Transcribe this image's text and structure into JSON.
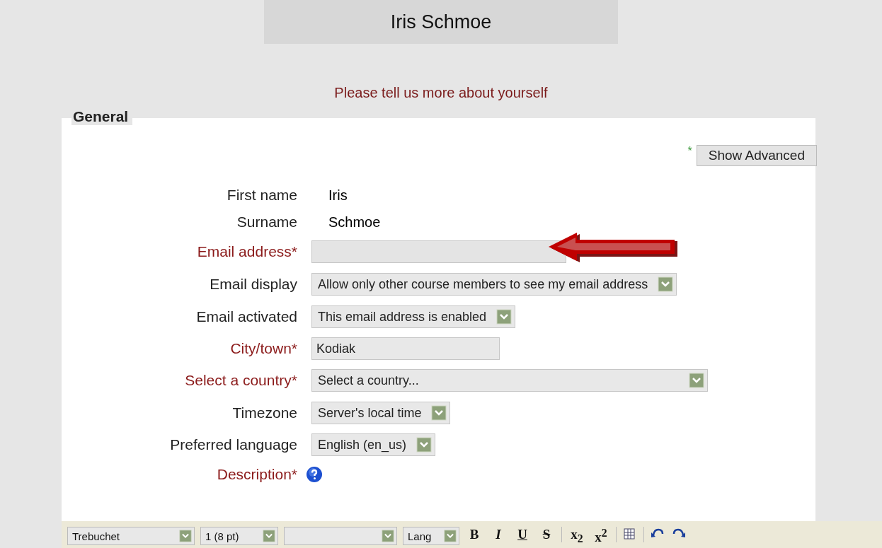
{
  "header": {
    "title": "Iris Schmoe",
    "subtitle": "Please tell us more about yourself"
  },
  "section": {
    "legend": "General",
    "advanced_button": {
      "label": "Show Advanced",
      "marker": "*"
    }
  },
  "rows": [
    {
      "label": "First name",
      "required": false,
      "kind": "static",
      "value": "Iris"
    },
    {
      "label": "Surname",
      "required": false,
      "kind": "static",
      "value": "Schmoe"
    },
    {
      "label": "Email address",
      "required": true,
      "kind": "input",
      "value": "",
      "highlighted": true
    },
    {
      "label": "Email display",
      "required": false,
      "kind": "select",
      "value": "Allow only other course members to see my email address"
    },
    {
      "label": "Email activated",
      "required": false,
      "kind": "select",
      "value": "This email address is enabled"
    },
    {
      "label": "City/town",
      "required": true,
      "kind": "input",
      "value": "Kodiak"
    },
    {
      "label": "Select a country",
      "required": true,
      "kind": "select",
      "value": "Select a country..."
    },
    {
      "label": "Timezone",
      "required": false,
      "kind": "select",
      "value": "Server's local time"
    },
    {
      "label": "Preferred language",
      "required": false,
      "kind": "select",
      "value": "English (en_us)"
    },
    {
      "label": "Description",
      "required": true,
      "kind": "help"
    }
  ],
  "toolbar": {
    "selects": [
      {
        "kind": "font",
        "value": "Trebuchet"
      },
      {
        "kind": "size",
        "value": "1 (8 pt)"
      },
      {
        "kind": "format"
      },
      {
        "kind": "lang",
        "value": "Lang"
      }
    ],
    "buttons": [
      {
        "kind": "bold",
        "label": "B"
      },
      {
        "kind": "italic",
        "label": "I"
      },
      {
        "kind": "underline",
        "label": "U"
      },
      {
        "kind": "strike",
        "label": "S"
      },
      {
        "kind": "sep"
      },
      {
        "kind": "sub",
        "label": "x$_{2}$"
      },
      {
        "kind": "sup",
        "label": "x$^{2}$"
      },
      {
        "kind": "sep"
      },
      {
        "kind": "table"
      },
      {
        "kind": "sep"
      },
      {
        "kind": "undo"
      },
      {
        "kind": "redo"
      }
    ]
  }
}
